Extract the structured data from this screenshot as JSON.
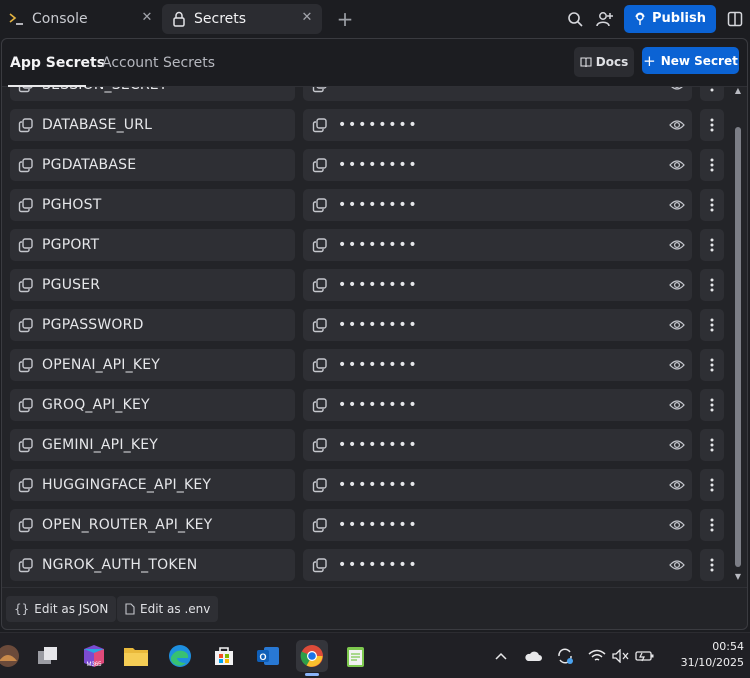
{
  "tabs": [
    {
      "label": "Console",
      "icon": "terminal-icon"
    },
    {
      "label": "Secrets",
      "icon": "lock-icon"
    }
  ],
  "toolbar": {
    "publish_label": "Publish"
  },
  "header": {
    "tabs": [
      "App Secrets",
      "Account Secrets"
    ],
    "active_tab": "App Secrets",
    "docs_label": "Docs",
    "new_secret_label": "New Secret"
  },
  "secrets": [
    {
      "key": "SESSION_SECRET",
      "value": "••••••••"
    },
    {
      "key": "DATABASE_URL",
      "value": "••••••••"
    },
    {
      "key": "PGDATABASE",
      "value": "••••••••"
    },
    {
      "key": "PGHOST",
      "value": "••••••••"
    },
    {
      "key": "PGPORT",
      "value": "••••••••"
    },
    {
      "key": "PGUSER",
      "value": "••••••••"
    },
    {
      "key": "PGPASSWORD",
      "value": "••••••••"
    },
    {
      "key": "OPENAI_API_KEY",
      "value": "••••••••"
    },
    {
      "key": "GROQ_API_KEY",
      "value": "••••••••"
    },
    {
      "key": "GEMINI_API_KEY",
      "value": "••••••••"
    },
    {
      "key": "HUGGINGFACE_API_KEY",
      "value": "••••••••"
    },
    {
      "key": "OPEN_ROUTER_API_KEY",
      "value": "••••••••"
    },
    {
      "key": "NGROK_AUTH_TOKEN",
      "value": "••••••••"
    }
  ],
  "footer": {
    "edit_json_label": "Edit as JSON",
    "edit_env_label": "Edit as .env"
  },
  "taskbar": {
    "apps": [
      "widgets",
      "task-view",
      "microsoft-365",
      "file-explorer",
      "edge",
      "store",
      "outlook",
      "chrome",
      "notepad"
    ],
    "clock_time": "00:54",
    "clock_date": "31/10/2025"
  },
  "colors": {
    "accent": "#0b63d4",
    "background": "#1c1d21",
    "row": "#2e2f34"
  }
}
